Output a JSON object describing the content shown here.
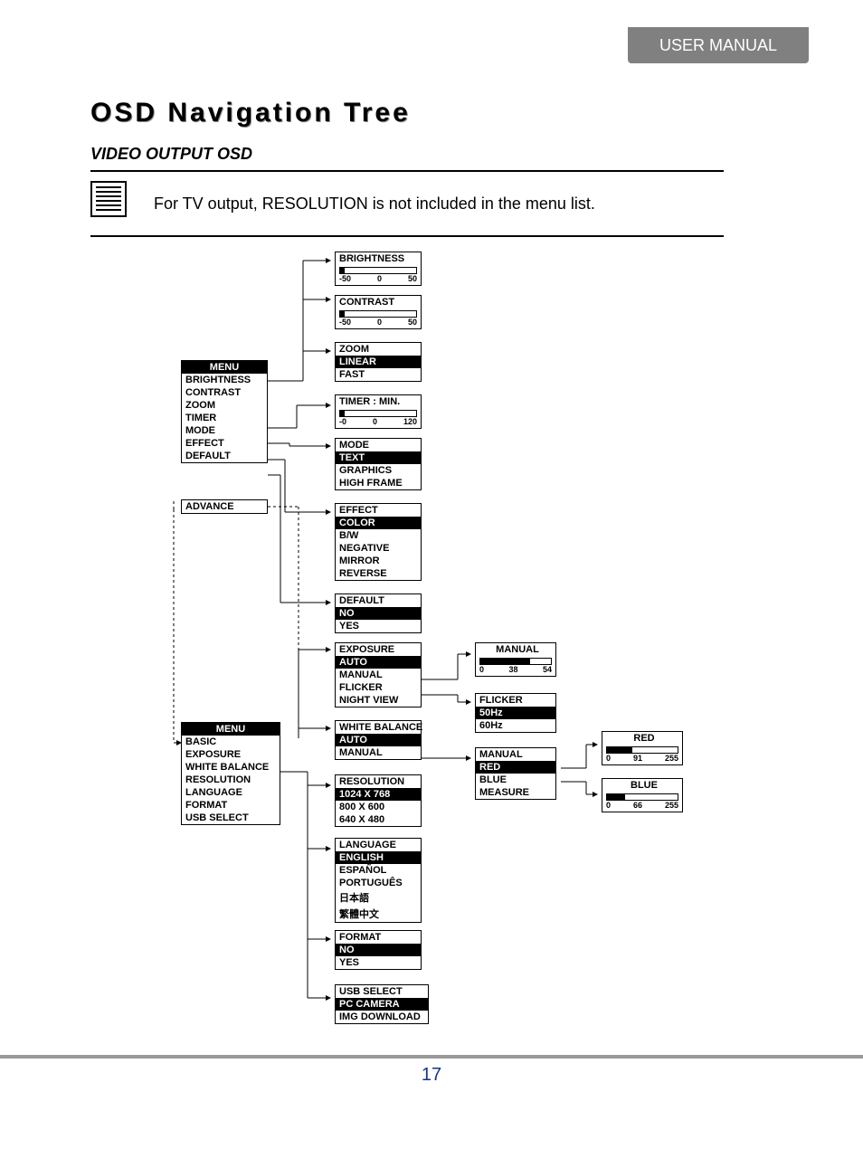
{
  "header": {
    "tab": "USER MANUAL"
  },
  "title": "OSD Navigation Tree",
  "subtitle": "VIDEO OUTPUT OSD",
  "note": "For TV output, RESOLUTION is not included in the menu list.",
  "page": "17",
  "menu1": {
    "title": "MENU",
    "items": [
      "BRIGHTNESS",
      "CONTRAST",
      "ZOOM",
      "TIMER",
      "MODE",
      "EFFECT",
      "DEFAULT",
      "ADVANCE"
    ]
  },
  "menu2": {
    "title": "MENU",
    "items": [
      "BASIC",
      "EXPOSURE",
      "WHITE BALANCE",
      "RESOLUTION",
      "LANGUAGE",
      "FORMAT",
      "USB SELECT"
    ]
  },
  "brightness": {
    "title": "BRIGHTNESS",
    "range": {
      "min": "-50",
      "mid": "0",
      "max": "50",
      "pct": 6
    }
  },
  "contrast": {
    "title": "CONTRAST",
    "range": {
      "min": "-50",
      "mid": "0",
      "max": "50",
      "pct": 6
    }
  },
  "zoom": {
    "title": "ZOOM",
    "items": [
      {
        "t": "LINEAR",
        "sel": true
      },
      {
        "t": "FAST",
        "sel": false
      }
    ]
  },
  "timer": {
    "title": "TIMER : MIN.",
    "range": {
      "min": "-0",
      "mid": "0",
      "max": "120",
      "pct": 6
    }
  },
  "mode": {
    "title": "MODE",
    "items": [
      {
        "t": "TEXT",
        "sel": true
      },
      {
        "t": "GRAPHICS",
        "sel": false
      },
      {
        "t": "HIGH FRAME",
        "sel": false
      }
    ]
  },
  "effect": {
    "title": "EFFECT",
    "items": [
      {
        "t": "COLOR",
        "sel": true
      },
      {
        "t": "B/W",
        "sel": false
      },
      {
        "t": "NEGATIVE",
        "sel": false
      },
      {
        "t": "MIRROR",
        "sel": false
      },
      {
        "t": "REVERSE",
        "sel": false
      }
    ]
  },
  "default_box": {
    "title": "DEFAULT",
    "items": [
      {
        "t": "NO",
        "sel": true
      },
      {
        "t": "YES",
        "sel": false
      }
    ]
  },
  "exposure": {
    "title": "EXPOSURE",
    "items": [
      {
        "t": "AUTO",
        "sel": true
      },
      {
        "t": "MANUAL",
        "sel": false
      },
      {
        "t": "FLICKER",
        "sel": false
      },
      {
        "t": "NIGHT VIEW",
        "sel": false
      }
    ]
  },
  "manual_exp": {
    "title": "MANUAL",
    "range": {
      "min": "0",
      "mid": "38",
      "max": "54",
      "pct": 70
    }
  },
  "flicker": {
    "title": "FLICKER",
    "items": [
      {
        "t": "50Hz",
        "sel": true
      },
      {
        "t": "60Hz",
        "sel": false
      }
    ]
  },
  "whitebal": {
    "title": "WHITE BALANCE",
    "items": [
      {
        "t": "AUTO",
        "sel": true
      },
      {
        "t": "MANUAL",
        "sel": false
      }
    ]
  },
  "manual_wb": {
    "title": "MANUAL",
    "items": [
      {
        "t": "RED",
        "sel": true
      },
      {
        "t": "BLUE",
        "sel": false
      },
      {
        "t": "MEASURE",
        "sel": false
      }
    ]
  },
  "red": {
    "title": "RED",
    "range": {
      "min": "0",
      "mid": "91",
      "max": "255",
      "pct": 36
    }
  },
  "blue": {
    "title": "BLUE",
    "range": {
      "min": "0",
      "mid": "66",
      "max": "255",
      "pct": 26
    }
  },
  "resolution": {
    "title": "RESOLUTION",
    "items": [
      {
        "t": "1024 X 768",
        "sel": true
      },
      {
        "t": "800 X 600",
        "sel": false
      },
      {
        "t": "640 X 480",
        "sel": false
      }
    ]
  },
  "language": {
    "title": "LANGUAGE",
    "items": [
      {
        "t": "ENGLISH",
        "sel": true
      },
      {
        "t": "ESPAÑOL",
        "sel": false
      },
      {
        "t": "PORTUGUÊS",
        "sel": false
      },
      {
        "t": "日本語",
        "sel": false
      },
      {
        "t": "繁體中文",
        "sel": false
      }
    ]
  },
  "format": {
    "title": "FORMAT",
    "items": [
      {
        "t": "NO",
        "sel": true
      },
      {
        "t": "YES",
        "sel": false
      }
    ]
  },
  "usbselect": {
    "title": "USB SELECT",
    "items": [
      {
        "t": "PC CAMERA",
        "sel": true
      },
      {
        "t": "IMG DOWNLOAD",
        "sel": false
      }
    ]
  }
}
